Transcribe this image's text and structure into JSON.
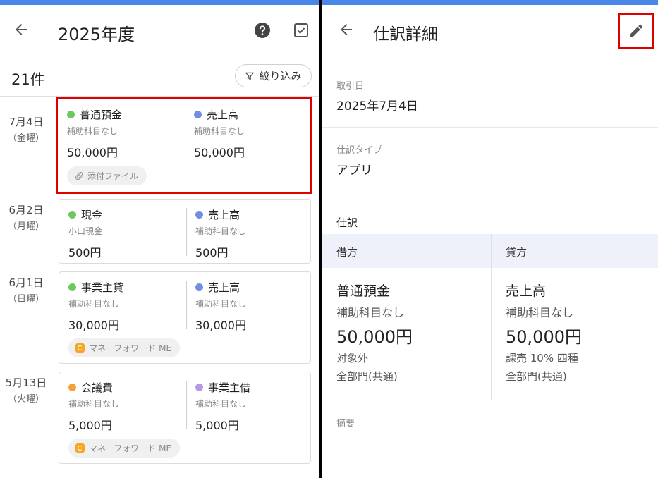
{
  "colors": {
    "accent": "#4a86e8",
    "highlight": "#e00000",
    "green": "#6cc95e",
    "blue": "#6f8fe0",
    "orange": "#f6a03a",
    "purple": "#b898e6"
  },
  "left": {
    "title": "2025年度",
    "count": "21件",
    "filter_label": "絞り込み",
    "entries": [
      {
        "date": "7月4日",
        "weekday": "（金曜）",
        "debit": {
          "account": "普通預金",
          "sub": "補助科目なし",
          "amount": "50,000円",
          "dot": "green"
        },
        "credit": {
          "account": "売上高",
          "sub": "補助科目なし",
          "amount": "50,000円",
          "dot": "blue"
        },
        "chip": "添付ファイル"
      },
      {
        "date": "6月2日",
        "weekday": "（月曜）",
        "debit": {
          "account": "現金",
          "sub": "小口現金",
          "amount": "500円",
          "dot": "green"
        },
        "credit": {
          "account": "売上高",
          "sub": "補助科目なし",
          "amount": "500円",
          "dot": "blue"
        }
      },
      {
        "date": "6月1日",
        "weekday": "（日曜）",
        "debit": {
          "account": "事業主貸",
          "sub": "補助科目なし",
          "amount": "30,000円",
          "dot": "green"
        },
        "credit": {
          "account": "売上高",
          "sub": "補助科目なし",
          "amount": "30,000円",
          "dot": "blue"
        },
        "chip": "マネーフォワード ME"
      },
      {
        "date": "5月13日",
        "weekday": "（火曜）",
        "debit": {
          "account": "会議費",
          "sub": "補助科目なし",
          "amount": "5,000円",
          "dot": "orange"
        },
        "credit": {
          "account": "事業主借",
          "sub": "補助科目なし",
          "amount": "5,000円",
          "dot": "purple"
        },
        "chip": "マネーフォワード ME"
      }
    ]
  },
  "right": {
    "title": "仕訳詳細",
    "date_label": "取引日",
    "date_value": "2025年7月4日",
    "type_label": "仕訳タイプ",
    "type_value": "アプリ",
    "journal_label": "仕訳",
    "debit_head": "借方",
    "credit_head": "貸方",
    "debit": {
      "account": "普通預金",
      "sub": "補助科目なし",
      "amount": "50,000円",
      "tax": "対象外",
      "dept": "全部門(共通)"
    },
    "credit": {
      "account": "売上高",
      "sub": "補助科目なし",
      "amount": "50,000円",
      "tax": "課売 10% 四種",
      "dept": "全部門(共通)"
    },
    "memo_label": "摘要"
  }
}
